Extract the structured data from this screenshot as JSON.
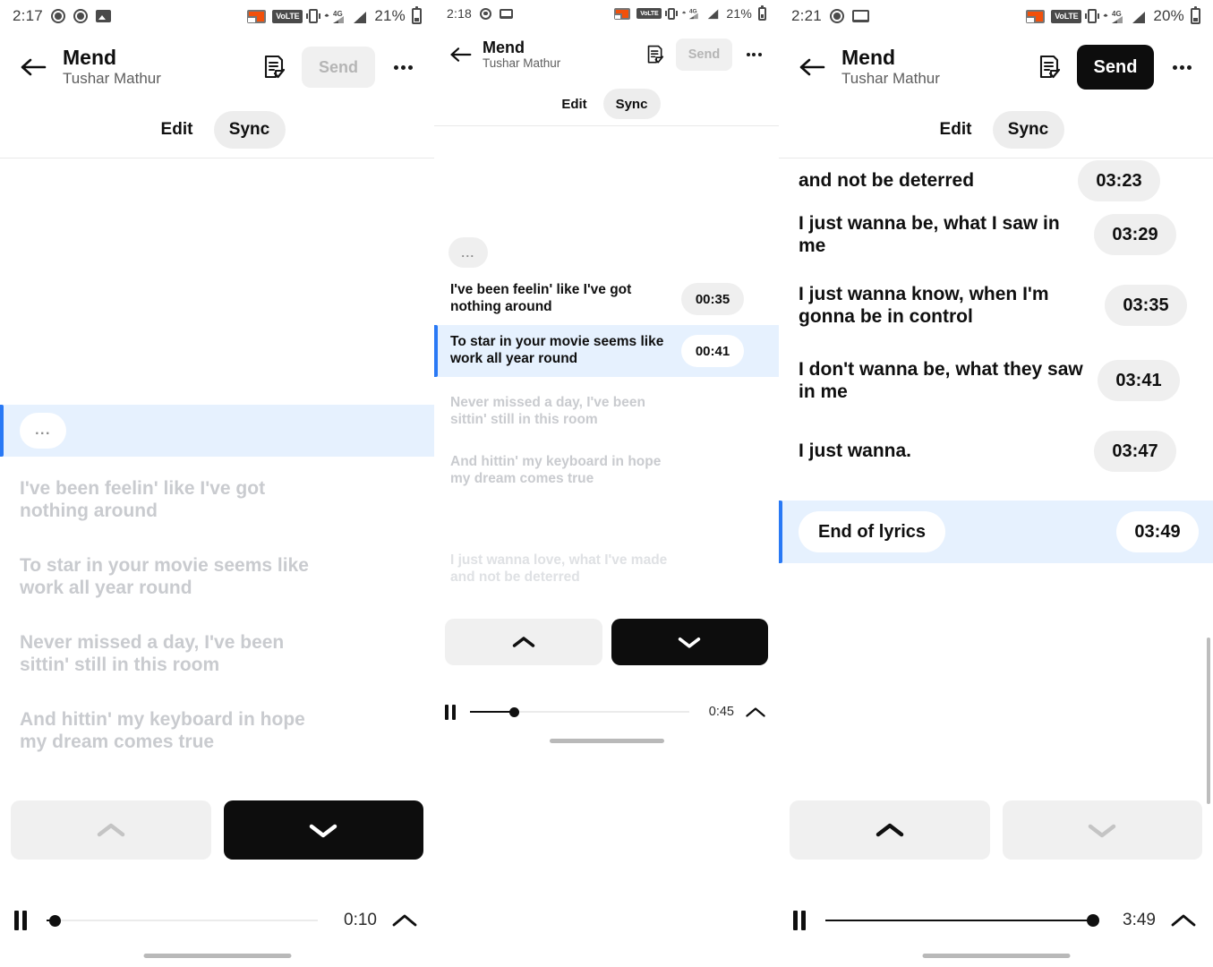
{
  "panels": [
    {
      "id": "panel-1",
      "status": {
        "time": "2:17",
        "battery": "21%",
        "network": "4G",
        "volte": "VoLTE"
      },
      "header": {
        "title": "Mend",
        "artist": "Tushar Mathur",
        "send_label": "Send",
        "send_enabled": false,
        "back_icon": "arrow-left-icon",
        "doc_icon": "document-check-icon",
        "more_icon": "more-options-icon"
      },
      "tabs": {
        "edit": "Edit",
        "sync": "Sync",
        "active": "Sync"
      },
      "lyrics": [
        {
          "text": "...",
          "state": "current",
          "chip": "",
          "is_ellipsis": true
        },
        {
          "text": "I've been feelin' like I've got nothing around",
          "state": "dim",
          "chip": ""
        },
        {
          "text": "To star in your movie seems like work all year round",
          "state": "dim",
          "chip": ""
        },
        {
          "text": "Never missed a day, I've been sittin' still in this room",
          "state": "dim",
          "chip": ""
        },
        {
          "text": "And hittin' my keyboard in hope my dream comes true",
          "state": "dim",
          "chip": ""
        }
      ],
      "nav": {
        "up_icon": "chevron-up-icon",
        "down_icon": "chevron-down-icon",
        "up_style": "light",
        "down_style": "dark",
        "up_enabled": false,
        "down_enabled": true
      },
      "player": {
        "pause_icon": "pause-icon",
        "time": "0:10",
        "progress_percent": 3,
        "expand_icon": "chevron-up-icon"
      },
      "scrollbar": false
    },
    {
      "id": "panel-2",
      "status": {
        "time": "2:18",
        "battery": "21%",
        "network": "4G",
        "volte": "VoLTE"
      },
      "header": {
        "title": "Mend",
        "artist": "Tushar Mathur",
        "send_label": "Send",
        "send_enabled": false,
        "back_icon": "arrow-left-icon",
        "doc_icon": "document-check-icon",
        "more_icon": "more-options-icon"
      },
      "tabs": {
        "edit": "Edit",
        "sync": "Sync",
        "active": "Sync"
      },
      "lyrics": [
        {
          "text": "...",
          "state": "plain",
          "chip": "",
          "is_ellipsis": true
        },
        {
          "text": "I've been feelin' like I've got nothing around",
          "state": "plain",
          "chip": "00:35"
        },
        {
          "text": "To star in your movie seems like work all year round",
          "state": "current",
          "chip": "00:41"
        },
        {
          "text": "Never missed a day, I've been sittin' still in this room",
          "state": "dim",
          "chip": ""
        },
        {
          "text": "And hittin' my keyboard in hope my dream comes true",
          "state": "dim",
          "chip": ""
        },
        {
          "text": "I just wanna love, what I've made and not be deterred",
          "state": "dimmer",
          "chip": ""
        }
      ],
      "nav": {
        "up_icon": "chevron-up-icon",
        "down_icon": "chevron-down-icon",
        "up_style": "light",
        "down_style": "dark",
        "up_enabled": true,
        "down_enabled": true
      },
      "player": {
        "pause_icon": "pause-icon",
        "time": "0:45",
        "progress_percent": 20,
        "expand_icon": "chevron-up-icon"
      },
      "scrollbar": false
    },
    {
      "id": "panel-3",
      "status": {
        "time": "2:21",
        "battery": "20%",
        "network": "4G",
        "volte": "VoLTE"
      },
      "header": {
        "title": "Mend",
        "artist": "Tushar Mathur",
        "send_label": "Send",
        "send_enabled": true,
        "back_icon": "arrow-left-icon",
        "doc_icon": "document-check-icon",
        "more_icon": "more-options-icon"
      },
      "tabs": {
        "edit": "Edit",
        "sync": "Sync",
        "active": "Sync"
      },
      "lyrics": [
        {
          "text": "and not be deterred",
          "state": "plain",
          "chip": "03:23",
          "clipped": true
        },
        {
          "text": "I just wanna be, what I saw in me",
          "state": "plain",
          "chip": "03:29"
        },
        {
          "text": "I just wanna know, when I'm gonna be in control",
          "state": "plain",
          "chip": "03:35"
        },
        {
          "text": "I don't wanna be, what they saw in me",
          "state": "plain",
          "chip": "03:41"
        },
        {
          "text": "I just wanna.",
          "state": "plain",
          "chip": "03:47"
        },
        {
          "text": "End of lyrics",
          "state": "current",
          "chip": "03:49",
          "text_chip": true
        }
      ],
      "nav": {
        "up_icon": "chevron-up-icon",
        "down_icon": "chevron-down-icon",
        "up_style": "light",
        "down_style": "light",
        "up_enabled": true,
        "down_enabled": false
      },
      "player": {
        "pause_icon": "pause-icon",
        "time": "3:49",
        "progress_percent": 100,
        "expand_icon": "chevron-up-icon"
      },
      "scrollbar": true
    }
  ],
  "colors": {
    "accent_blue": "#2979f5",
    "row_highlight": "#e6f1fe",
    "dark_button": "#0d0d0d",
    "light_button": "#f0f0f0",
    "chip_grey": "#efefef",
    "dim_text": "#c9cbcf",
    "cast_orange": "#f2500a"
  }
}
